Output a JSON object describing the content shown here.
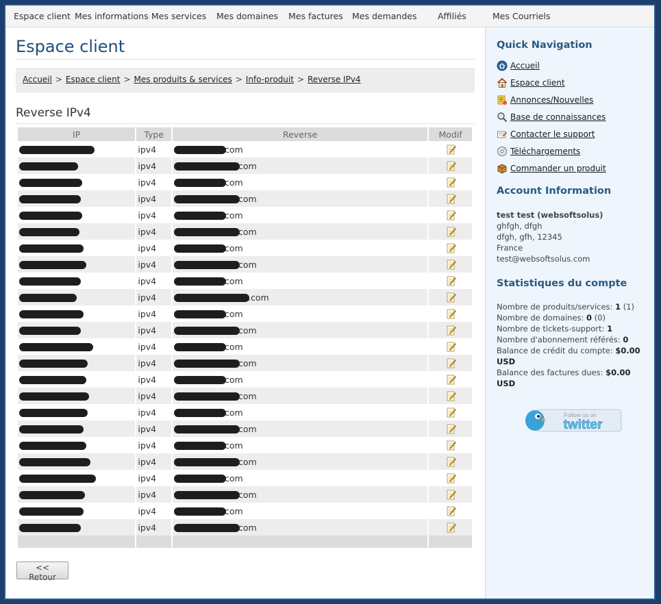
{
  "topnav": [
    "Espace client",
    "Mes informations",
    "Mes services",
    "Mes domaines",
    "Mes factures",
    "Mes demandes",
    "Affiliés",
    "Mes Courriels"
  ],
  "page_title": "Espace client",
  "breadcrumb": [
    "Accueil",
    "Espace client",
    "Mes produits & services",
    "Info-produit",
    "Reverse IPv4"
  ],
  "breadcrumb_sep": ">",
  "section_title": "Reverse IPv4",
  "table": {
    "headers": {
      "ip": "IP",
      "type": "Type",
      "reverse": "Reverse",
      "modif": "Modif"
    },
    "rows": [
      {
        "type": "ipv4",
        "reverse": "com"
      },
      {
        "type": "ipv4",
        "reverse": "com"
      },
      {
        "type": "ipv4",
        "reverse": "com"
      },
      {
        "type": "ipv4",
        "reverse": "com"
      },
      {
        "type": "ipv4",
        "reverse": "com"
      },
      {
        "type": "ipv4",
        "reverse": "com"
      },
      {
        "type": "ipv4",
        "reverse": "com"
      },
      {
        "type": "ipv4",
        "reverse": "com"
      },
      {
        "type": "ipv4",
        "reverse": "com"
      },
      {
        "type": "ipv4",
        "reverse": ".com"
      },
      {
        "type": "ipv4",
        "reverse": "com"
      },
      {
        "type": "ipv4",
        "reverse": "com"
      },
      {
        "type": "ipv4",
        "reverse": "com"
      },
      {
        "type": "ipv4",
        "reverse": "com"
      },
      {
        "type": "ipv4",
        "reverse": "com"
      },
      {
        "type": "ipv4",
        "reverse": "com"
      },
      {
        "type": "ipv4",
        "reverse": "com"
      },
      {
        "type": "ipv4",
        "reverse": "com"
      },
      {
        "type": "ipv4",
        "reverse": "com"
      },
      {
        "type": "ipv4",
        "reverse": "com"
      },
      {
        "type": "ipv4",
        "reverse": "com"
      },
      {
        "type": "ipv4",
        "reverse": "com"
      },
      {
        "type": "ipv4",
        "reverse": "com"
      },
      {
        "type": "ipv4",
        "reverse": "com"
      }
    ]
  },
  "back_button": "<< Retour",
  "sidebar": {
    "quick_nav_title": "Quick Navigation",
    "quick_nav": [
      {
        "label": "Accueil",
        "icon": "home-circle-icon"
      },
      {
        "label": "Espace client",
        "icon": "house-icon"
      },
      {
        "label": "Annonces/Nouvelles",
        "icon": "news-icon"
      },
      {
        "label": "Base de connaissances",
        "icon": "magnifier-icon"
      },
      {
        "label": "Contacter le support",
        "icon": "support-icon"
      },
      {
        "label": "Téléchargements",
        "icon": "disc-icon"
      },
      {
        "label": "Commander un produit",
        "icon": "box-icon"
      }
    ],
    "account_title": "Account Information",
    "account": {
      "name": "test test (websoftsolus)",
      "line1": "ghfgh, dfgh",
      "line2": "dfgh, gfh, 12345",
      "country": "France",
      "email": "test@websoftsolus.com"
    },
    "stats_title": "Statistiques du compte",
    "stats": {
      "products_label": "Nombre de produits/services:",
      "products_value": "1",
      "products_extra": "(1)",
      "domains_label": "Nombre de domaines:",
      "domains_value": "0",
      "domains_extra": "(0)",
      "tickets_label": "Nombre de tickets-support:",
      "tickets_value": "1",
      "referrals_label": "Nombre d'abonnement référés:",
      "referrals_value": "0",
      "credit_label": "Balance de crédit du compte:",
      "credit_value": "$0.00",
      "credit_unit": "USD",
      "due_label": "Balance des factures dues:",
      "due_value": "$0.00",
      "due_unit": "USD"
    },
    "twitter_small": "Follow us on",
    "twitter_big": "twitter"
  }
}
